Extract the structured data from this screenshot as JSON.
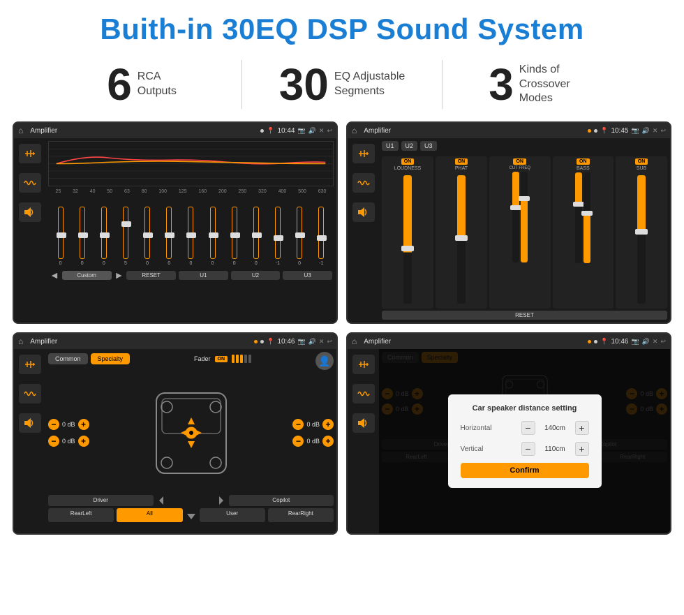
{
  "header": {
    "title": "Buith-in 30EQ DSP Sound System"
  },
  "stats": [
    {
      "number": "6",
      "text": "RCA\nOutputs"
    },
    {
      "number": "30",
      "text": "EQ Adjustable\nSegments"
    },
    {
      "number": "3",
      "text": "Kinds of\nCrossover Modes"
    }
  ],
  "screens": [
    {
      "id": "screen1",
      "status": {
        "title": "Amplifier",
        "time": "10:44"
      },
      "type": "eq"
    },
    {
      "id": "screen2",
      "status": {
        "title": "Amplifier",
        "time": "10:45"
      },
      "type": "channels"
    },
    {
      "id": "screen3",
      "status": {
        "title": "Amplifier",
        "time": "10:46"
      },
      "type": "speaker"
    },
    {
      "id": "screen4",
      "status": {
        "title": "Amplifier",
        "time": "10:46"
      },
      "type": "distance"
    }
  ],
  "eq": {
    "freqs": [
      "25",
      "32",
      "40",
      "50",
      "63",
      "80",
      "100",
      "125",
      "160",
      "200",
      "250",
      "320",
      "400",
      "500",
      "630"
    ],
    "values": [
      "0",
      "0",
      "0",
      "5",
      "0",
      "0",
      "0",
      "0",
      "0",
      "0",
      "-1",
      "0",
      "-1"
    ],
    "preset": "Custom",
    "buttons": [
      "RESET",
      "U1",
      "U2",
      "U3"
    ]
  },
  "channels": {
    "labels": [
      "U1",
      "U2",
      "U3"
    ],
    "controls": [
      "LOUDNESS",
      "PHAT",
      "CUT FREQ",
      "BASS",
      "SUB"
    ],
    "reset": "RESET"
  },
  "speaker": {
    "tabs": [
      "Common",
      "Specialty"
    ],
    "fader": "Fader",
    "fader_on": "ON",
    "db_values": [
      "0 dB",
      "0 dB",
      "0 dB",
      "0 dB"
    ],
    "buttons": [
      "Driver",
      "All",
      "User",
      "Copilot",
      "RearLeft",
      "RearRight"
    ]
  },
  "distance_dialog": {
    "title": "Car speaker distance setting",
    "horizontal_label": "Horizontal",
    "horizontal_value": "140cm",
    "vertical_label": "Vertical",
    "vertical_value": "110cm",
    "confirm": "Confirm"
  }
}
